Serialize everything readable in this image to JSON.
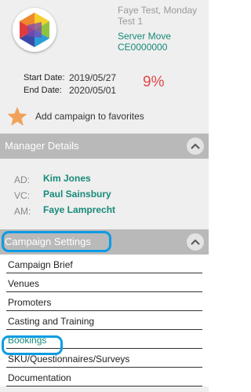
{
  "header": {
    "client_name": "Faye Test, Monday Test 1",
    "project_name": "Server Move",
    "project_code": "CE0000000",
    "start_date_label": "Start Date:",
    "start_date": "2019/05/27",
    "end_date_label": "End Date:",
    "end_date": "2020/05/01",
    "progress_percent": "9%",
    "favorites_label": "Add campaign to favorites"
  },
  "manager_section": {
    "title": "Manager Details",
    "rows": [
      {
        "role": "AD:",
        "name": "Kim Jones"
      },
      {
        "role": "VC:",
        "name": "Paul Sainsbury"
      },
      {
        "role": "AM:",
        "name": "Faye Lamprecht"
      }
    ]
  },
  "campaign_section": {
    "title": "Campaign Settings",
    "items": [
      {
        "label": "Campaign Brief"
      },
      {
        "label": "Venues"
      },
      {
        "label": "Promoters"
      },
      {
        "label": "Casting and Training"
      },
      {
        "label": "Bookings"
      },
      {
        "label": "SKU/Questionnaires/Surveys"
      },
      {
        "label": "Documentation"
      }
    ],
    "active_item": "Bookings"
  },
  "colors": {
    "accent_teal": "#178a78",
    "percent_red": "#e04848",
    "highlight_blue": "#0b9ce3",
    "section_grey": "#b9b9b9",
    "star_orange": "#f2a15a"
  },
  "icons": {
    "logo": "hexagon-logo",
    "favorite": "star-icon",
    "collapse": "chevron-up-icon"
  }
}
